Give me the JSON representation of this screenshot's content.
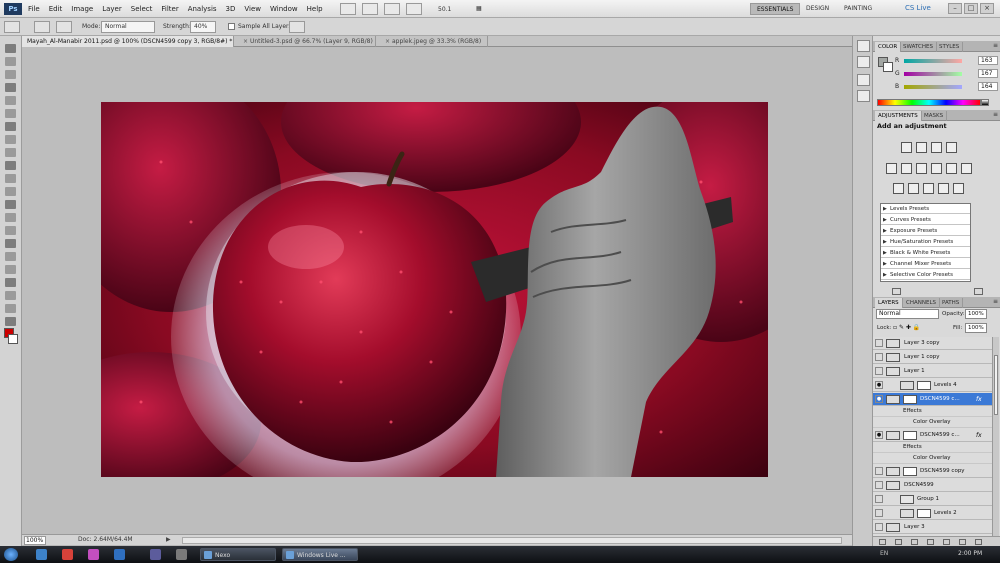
{
  "app": {
    "logo": "Ps",
    "menus": [
      "File",
      "Edit",
      "Image",
      "Layer",
      "Select",
      "Filter",
      "Analysis",
      "3D",
      "View",
      "Window",
      "Help"
    ],
    "zoom_menu": "50.1",
    "workspaces": [
      "ESSENTIALS",
      "DESIGN",
      "PAINTING"
    ],
    "active_workspace": "ESSENTIALS",
    "cs_live": "CS Live"
  },
  "options_bar": {
    "mode_label": "Mode:",
    "mode_value": "Normal",
    "strength_label": "Strength:",
    "strength_value": "40%",
    "sample_all_label": "Sample All Layers"
  },
  "document_tabs": [
    {
      "label": "Mayah_Al-Manabir 2011.psd @ 100% (DSCN4599 copy 3, RGB/8#) *",
      "active": true
    },
    {
      "label": "Untitled-3.psd @ 66.7% (Layer 9, RGB/8)",
      "active": false
    },
    {
      "label": "applek.jpeg @ 33.3% (RGB/8)",
      "active": false
    }
  ],
  "status_bar": {
    "zoom": "100%",
    "doc_info": "Doc: 2.64M/64.4M"
  },
  "color_panel": {
    "tabs": [
      "COLOR",
      "SWATCHES",
      "STYLES"
    ],
    "active_tab": "COLOR",
    "foreground": "#a3a7a4",
    "channels": [
      {
        "label": "R",
        "value": "163"
      },
      {
        "label": "G",
        "value": "167"
      },
      {
        "label": "B",
        "value": "164"
      }
    ]
  },
  "adjustments_panel": {
    "tabs": [
      "ADJUSTMENTS",
      "MASKS"
    ],
    "active_tab": "ADJUSTMENTS",
    "title": "Add an adjustment",
    "presets": [
      "Levels Presets",
      "Curves Presets",
      "Exposure Presets",
      "Hue/Saturation Presets",
      "Black & White Presets",
      "Channel Mixer Presets",
      "Selective Color Presets"
    ]
  },
  "layers_panel": {
    "tabs": [
      "LAYERS",
      "CHANNELS",
      "PATHS"
    ],
    "active_tab": "LAYERS",
    "blend_mode": "Normal",
    "opacity_label": "Opacity:",
    "opacity_value": "100%",
    "lock_label": "Lock:",
    "fill_label": "Fill:",
    "fill_value": "100%",
    "layers": [
      {
        "name": "Layer 3 copy",
        "visible": false,
        "selected": false,
        "kind": "layer"
      },
      {
        "name": "Layer 1 copy",
        "visible": false,
        "selected": false,
        "kind": "layer"
      },
      {
        "name": "Layer 1",
        "visible": false,
        "selected": false,
        "kind": "layer"
      },
      {
        "name": "Levels 4",
        "visible": true,
        "selected": false,
        "kind": "adjustment"
      },
      {
        "name": "DSCN4599 c...",
        "visible": true,
        "selected": true,
        "kind": "layer",
        "fx": "fx"
      },
      {
        "name": "Effects",
        "kind": "effects"
      },
      {
        "name": "Color Overlay",
        "kind": "effect"
      },
      {
        "name": "DSCN4599 c...",
        "visible": true,
        "selected": false,
        "kind": "layer",
        "fx": "fx"
      },
      {
        "name": "Effects",
        "kind": "effects"
      },
      {
        "name": "Color Overlay",
        "kind": "effect"
      },
      {
        "name": "DSCN4599 copy",
        "visible": false,
        "selected": false,
        "kind": "layer"
      },
      {
        "name": "DSCN4599",
        "visible": false,
        "selected": false,
        "kind": "layer"
      },
      {
        "name": "Group 1",
        "visible": false,
        "selected": false,
        "kind": "group"
      },
      {
        "name": "Levels 2",
        "visible": false,
        "selected": false,
        "kind": "adjustment"
      },
      {
        "name": "Layer 3",
        "visible": false,
        "selected": false,
        "kind": "layer"
      },
      {
        "name": "Levels 1",
        "visible": false,
        "selected": false,
        "kind": "adjustment"
      }
    ]
  },
  "taskbar": {
    "tasks": [
      {
        "label": "Nexo",
        "active": false
      },
      {
        "label": "Windows Live ...",
        "active": true
      }
    ],
    "tray": "EN",
    "clock": "2:00 PM"
  }
}
